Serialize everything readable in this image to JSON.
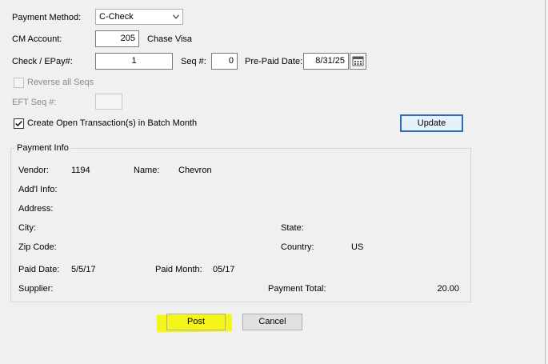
{
  "form": {
    "payment_method_label": "Payment Method:",
    "payment_method_value": "C-Check",
    "cm_account_label": "CM Account:",
    "cm_account_value": "205",
    "cm_account_name": "Chase Visa",
    "check_label": "Check / EPay#:",
    "check_value": "1",
    "seq_label": "Seq #:",
    "seq_value": "0",
    "prepaid_label": "Pre-Paid Date:",
    "prepaid_value": "8/31/25",
    "reverse_label": "Reverse all Seqs",
    "reverse_checked": false,
    "eft_label": "EFT Seq #:",
    "eft_value": "",
    "create_open_label": "Create Open Transaction(s) in Batch Month",
    "create_open_checked": true,
    "update_button": "Update"
  },
  "payment_info": {
    "title": "Payment Info",
    "vendor_label": "Vendor:",
    "vendor_value": "1194",
    "name_label": "Name:",
    "name_value": "Chevron",
    "addl_label": "Add'l Info:",
    "address_label": "Address:",
    "city_label": "City:",
    "state_label": "State:",
    "zip_label": "Zip Code:",
    "country_label": "Country:",
    "country_value": "US",
    "paid_date_label": "Paid Date:",
    "paid_date_value": "5/5/17",
    "paid_month_label": "Paid Month:",
    "paid_month_value": "05/17",
    "supplier_label": "Supplier:",
    "payment_total_label": "Payment Total:",
    "payment_total_value": "20.00"
  },
  "actions": {
    "post_button": "Post",
    "cancel_button": "Cancel"
  },
  "colors": {
    "window_bg": "#f0f0f0",
    "highlight": "#f5f51a",
    "default_button_border": "#2f6bbd"
  },
  "icons": {
    "dropdown": "chevron-down-icon",
    "calendar": "calendar-icon",
    "check": "checkmark-icon"
  }
}
